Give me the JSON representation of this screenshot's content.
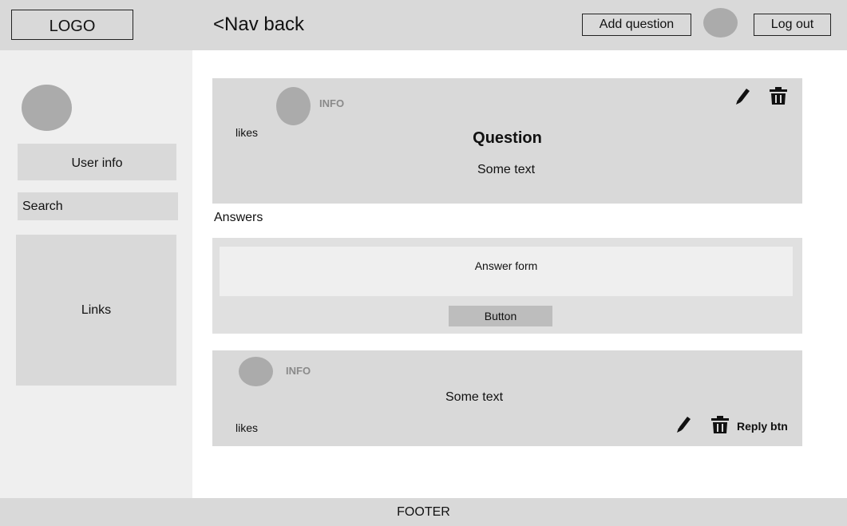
{
  "header": {
    "logo": "LOGO",
    "nav_back": "<Nav back",
    "add_question": "Add question",
    "log_out": "Log out"
  },
  "sidebar": {
    "user_info": "User info",
    "search_placeholder": "Search",
    "links": "Links"
  },
  "question": {
    "info": "INFO",
    "likes": "likes",
    "title": "Question",
    "text": "Some text"
  },
  "answers_label": "Answers",
  "answer_form": {
    "placeholder": "Answer form",
    "button": "Button"
  },
  "answer": {
    "info": "INFO",
    "text": "Some text",
    "likes": "likes",
    "reply": "Reply btn"
  },
  "footer": "FOOTER",
  "icons": {
    "edit": "pencil-icon",
    "delete": "trash-icon"
  },
  "colors": {
    "header_bg": "#d9d9d9",
    "sidebar_bg": "#efefef",
    "card_bg": "#d9d9d9",
    "avatar": "#ababab",
    "button_bg": "#bdbdbd"
  }
}
